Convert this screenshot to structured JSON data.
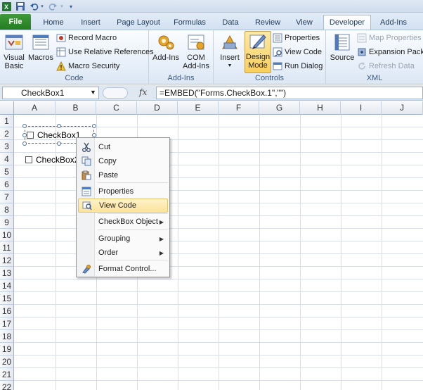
{
  "quick_access": {
    "excel_icon": "excel-icon",
    "save_icon": "save-icon",
    "undo_icon": "undo-icon",
    "redo_icon": "redo-icon"
  },
  "tabs": [
    {
      "label": "File"
    },
    {
      "label": "Home"
    },
    {
      "label": "Insert"
    },
    {
      "label": "Page Layout"
    },
    {
      "label": "Formulas"
    },
    {
      "label": "Data"
    },
    {
      "label": "Review"
    },
    {
      "label": "View"
    },
    {
      "label": "Developer"
    },
    {
      "label": "Add-Ins"
    }
  ],
  "ribbon": {
    "code": {
      "label": "Code",
      "visual_basic": "Visual\nBasic",
      "macros": "Macros",
      "record_macro": "Record Macro",
      "use_relative_references": "Use Relative References",
      "macro_security": "Macro Security"
    },
    "addins": {
      "label": "Add-Ins",
      "add_ins": "Add-Ins",
      "com_add_ins": "COM\nAdd-Ins"
    },
    "controls": {
      "label": "Controls",
      "insert": "Insert",
      "design_mode": "Design\nMode",
      "properties": "Properties",
      "view_code": "View Code",
      "run_dialog": "Run Dialog"
    },
    "xml": {
      "label": "XML",
      "source": "Source",
      "map_properties": "Map Properties",
      "expansion_packs": "Expansion Packs",
      "refresh_data": "Refresh Data"
    }
  },
  "formula_bar": {
    "name_box": "CheckBox1",
    "fx": "fx",
    "formula": "=EMBED(\"Forms.CheckBox.1\",\"\")"
  },
  "sheet": {
    "columns": [
      "A",
      "B",
      "C",
      "D",
      "E",
      "F",
      "G",
      "H",
      "I",
      "J"
    ],
    "rows": [
      "1",
      "2",
      "3",
      "4",
      "5",
      "6",
      "7",
      "8",
      "9",
      "10",
      "11",
      "12",
      "13",
      "14",
      "15",
      "16",
      "17",
      "18",
      "19",
      "20",
      "21",
      "22"
    ],
    "checkbox1": "CheckBox1",
    "checkbox2": "CheckBox2"
  },
  "context_menu": {
    "items": [
      {
        "label": "Cut",
        "icon": "scissors-icon"
      },
      {
        "label": "Copy",
        "icon": "copy-icon"
      },
      {
        "label": "Paste",
        "icon": "paste-icon"
      },
      {
        "label": "Properties",
        "icon": "properties-icon"
      },
      {
        "label": "View Code",
        "icon": "view-code-icon"
      },
      {
        "label": "CheckBox Object"
      },
      {
        "label": "Grouping"
      },
      {
        "label": "Order"
      },
      {
        "label": "Format Control...",
        "icon": "format-control-icon"
      }
    ]
  },
  "colors": {
    "file_tab": "#2f8c2c",
    "accent": "#1e395b",
    "highlight": "#fbe39a"
  }
}
